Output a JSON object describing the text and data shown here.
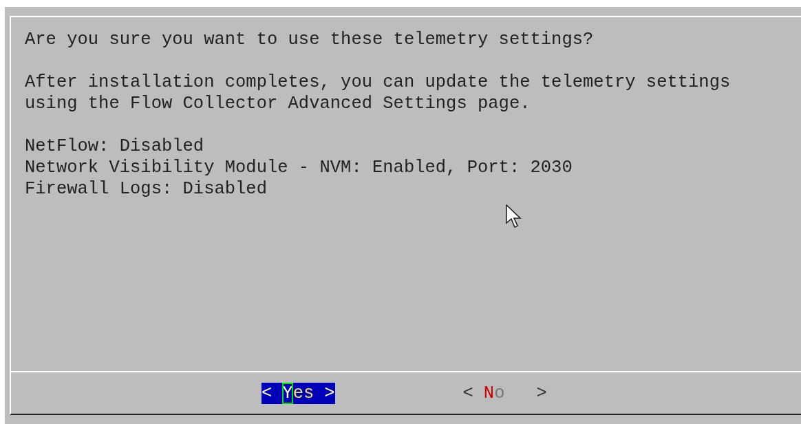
{
  "dialog": {
    "paragraphs": [
      [
        "Are you sure you want to use these telemetry settings?"
      ],
      [
        "After installation completes, you can update the telemetry settings",
        "using the Flow Collector Advanced Settings page."
      ],
      [
        "NetFlow: Disabled",
        "Network Visibility Module - NVM: Enabled, Port: 2030",
        "Firewall Logs: Disabled"
      ]
    ],
    "buttons": [
      {
        "open": "<",
        "hotkey": "Y",
        "rest": "es",
        "close": ">",
        "selected": true
      },
      {
        "open": "<",
        "hotkey": "N",
        "rest": "o",
        "close": ">",
        "selected": false
      }
    ]
  }
}
